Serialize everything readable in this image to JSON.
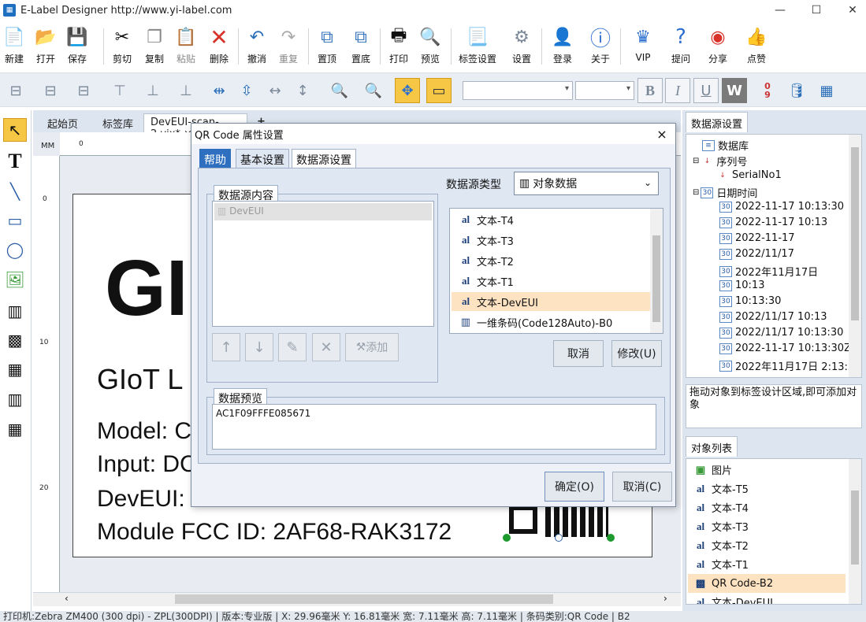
{
  "window": {
    "title": "E-Label Designer http://www.yi-label.com",
    "app_icon": "label-app-icon"
  },
  "toolbar": {
    "buttons": [
      {
        "label": "新建",
        "icon": "new-file-icon"
      },
      {
        "label": "打开",
        "icon": "folder-open-icon"
      },
      {
        "label": "保存",
        "icon": "save-icon"
      },
      {
        "label": "剪切",
        "icon": "scissors-icon"
      },
      {
        "label": "复制",
        "icon": "copy-icon"
      },
      {
        "label": "粘贴",
        "icon": "paste-icon",
        "disabled": true
      },
      {
        "label": "删除",
        "icon": "delete-x-icon"
      },
      {
        "label": "撤消",
        "icon": "undo-icon"
      },
      {
        "label": "重复",
        "icon": "redo-icon",
        "disabled": true
      },
      {
        "label": "置顶",
        "icon": "bring-front-icon"
      },
      {
        "label": "置底",
        "icon": "send-back-icon"
      },
      {
        "label": "打印",
        "icon": "printer-icon"
      },
      {
        "label": "预览",
        "icon": "preview-icon"
      },
      {
        "label": "标签设置",
        "icon": "label-settings-icon"
      },
      {
        "label": "设置",
        "icon": "gear-icon"
      },
      {
        "label": "登录",
        "icon": "user-icon"
      },
      {
        "label": "关于",
        "icon": "info-icon"
      },
      {
        "label": "VIP",
        "icon": "crown-icon"
      },
      {
        "label": "提问",
        "icon": "question-icon"
      },
      {
        "label": "分享",
        "icon": "weibo-icon"
      },
      {
        "label": "点赞",
        "icon": "like-icon"
      }
    ]
  },
  "format_toolbar": {
    "bold": "B",
    "italic": "I",
    "underline": "U",
    "word": "W",
    "sort_label": "0\n9"
  },
  "tabs": {
    "items": [
      "起始页",
      "标签库",
      "DevEUI-scan-2.vix*"
    ],
    "close": "×",
    "add": "+"
  },
  "ruler": {
    "unit": "MM",
    "h_ticks": [
      "0"
    ],
    "v_ticks": [
      "0",
      "10",
      "20"
    ]
  },
  "label_content": {
    "logo_text": "GI",
    "line1": "GIoT L",
    "line2": "Model: C",
    "line3": "Input: DC",
    "line4": "DevEUI: ",
    "line5": "Module FCC ID: 2AF68-RAK3172"
  },
  "right_panel": {
    "ds_tab": "数据源设置",
    "tree": [
      {
        "label": "数据库",
        "level": 0,
        "icon": "database-icon"
      },
      {
        "label": "序列号",
        "level": 0,
        "icon": "sort-icon"
      },
      {
        "label": "SerialNo1",
        "level": 1,
        "icon": "sort-icon"
      },
      {
        "label": "日期时间",
        "level": 0,
        "icon": "calendar-icon"
      },
      {
        "label": "2022-11-17 10:13:30",
        "level": 1,
        "icon": "calendar-icon"
      },
      {
        "label": "2022-11-17 10:13",
        "level": 1,
        "icon": "calendar-icon"
      },
      {
        "label": "2022-11-17",
        "level": 1,
        "icon": "calendar-icon"
      },
      {
        "label": "2022/11/17",
        "level": 1,
        "icon": "calendar-icon"
      },
      {
        "label": "2022年11月17日",
        "level": 1,
        "icon": "calendar-icon"
      },
      {
        "label": "10:13",
        "level": 1,
        "icon": "calendar-icon"
      },
      {
        "label": "10:13:30",
        "level": 1,
        "icon": "calendar-icon"
      },
      {
        "label": "2022/11/17 10:13",
        "level": 1,
        "icon": "calendar-icon"
      },
      {
        "label": "2022/11/17 10:13:30",
        "level": 1,
        "icon": "calendar-icon"
      },
      {
        "label": "2022-11-17 10:13:30Z",
        "level": 1,
        "icon": "calendar-icon"
      },
      {
        "label": "2022年11月17日 2:13:3",
        "level": 1,
        "icon": "calendar-icon"
      }
    ],
    "hint": "拖动对象到标签设计区域,即可添加对象",
    "obj_tab": "对象列表",
    "objects": [
      {
        "label": "图片",
        "icon": "image-icon"
      },
      {
        "label": "文本-T5",
        "icon": "text-icon"
      },
      {
        "label": "文本-T4",
        "icon": "text-icon"
      },
      {
        "label": "文本-T3",
        "icon": "text-icon"
      },
      {
        "label": "文本-T2",
        "icon": "text-icon"
      },
      {
        "label": "文本-T1",
        "icon": "text-icon"
      },
      {
        "label": "QR Code-B2",
        "icon": "qr-icon",
        "selected": true
      },
      {
        "label": "文本-DevEUI",
        "icon": "text-icon"
      }
    ]
  },
  "status": "打印机:Zebra ZM400 (300 dpi) - ZPL(300DPI)  |  版本:专业版  |  X: 29.96毫米 Y: 16.81毫米 宽: 7.11毫米 高: 7.11毫米 | 条码类别:QR Code | B2",
  "dialog": {
    "title": "QR Code 属性设置",
    "close": "×",
    "tabs": {
      "help": "帮助",
      "basic": "基本设置",
      "datasource": "数据源设置"
    },
    "ds_content_title": "数据源内容",
    "ds_content_items": [
      "DevEUI"
    ],
    "ds_type_label": "数据源类型",
    "ds_type_value": "对象数据",
    "ds_list": [
      {
        "label": "文本-T4",
        "icon": "text-icon"
      },
      {
        "label": "文本-T3",
        "icon": "text-icon"
      },
      {
        "label": "文本-T2",
        "icon": "text-icon"
      },
      {
        "label": "文本-T1",
        "icon": "text-icon"
      },
      {
        "label": "文本-DevEUI",
        "icon": "text-icon",
        "selected": true
      },
      {
        "label": "一维条码(Code128Auto)-B0",
        "icon": "barcode-icon"
      }
    ],
    "add_label": "添加",
    "cancel_label": "取消",
    "modify_label": "修改(U)",
    "preview_title": "数据预览",
    "preview_value": "AC1F09FFFE085671",
    "ok_label": "确定(O)",
    "cancel2_label": "取消(C)"
  },
  "colors": {
    "accent_blue": "#2f6fc0",
    "selection": "#fde3c2",
    "tool_active": "#f6c744"
  }
}
